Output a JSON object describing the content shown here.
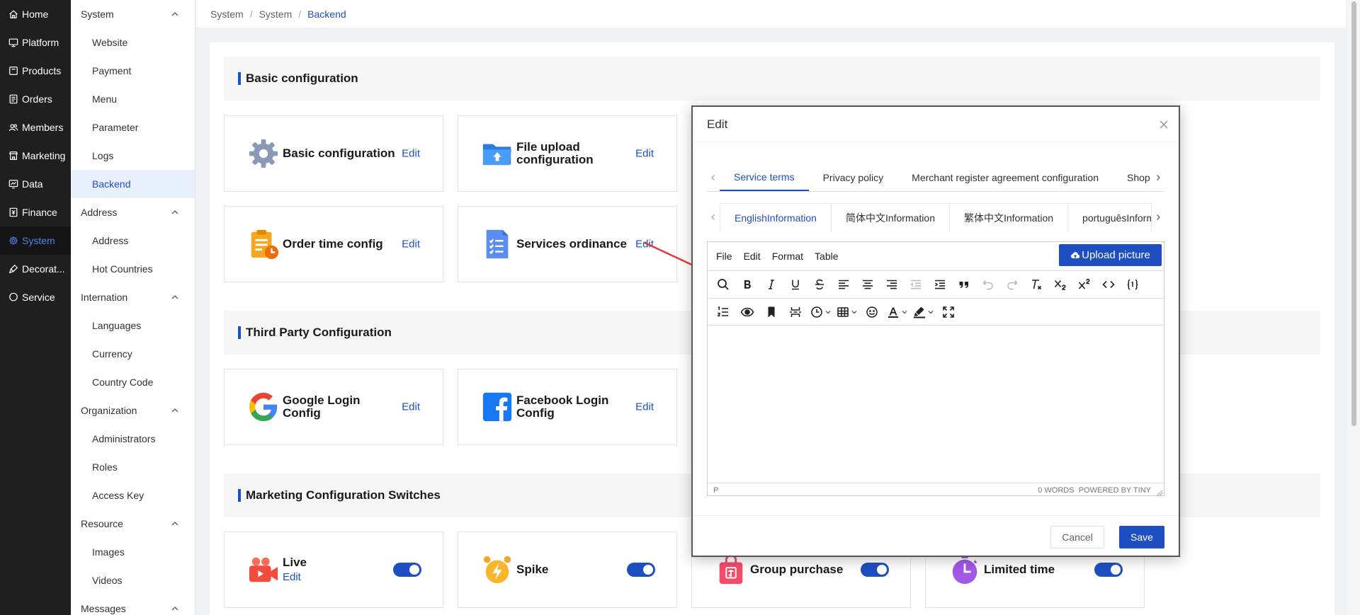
{
  "rail": [
    {
      "label": "Home",
      "icon": "home-icon"
    },
    {
      "label": "Platform",
      "icon": "monitor-icon"
    },
    {
      "label": "Products",
      "icon": "box-icon"
    },
    {
      "label": "Orders",
      "icon": "receipt-icon"
    },
    {
      "label": "Members",
      "icon": "users-icon"
    },
    {
      "label": "Marketing",
      "icon": "store-icon"
    },
    {
      "label": "Data",
      "icon": "chart-icon"
    },
    {
      "label": "Finance",
      "icon": "finance-icon"
    },
    {
      "label": "System",
      "icon": "gear-icon",
      "active": true
    },
    {
      "label": "Decorat...",
      "icon": "brush-icon"
    },
    {
      "label": "Service",
      "icon": "chat-icon"
    }
  ],
  "submenu": {
    "groups": [
      {
        "label": "System",
        "items": [
          "Website",
          "Payment",
          "Menu",
          "Parameter",
          "Logs",
          "Backend"
        ]
      },
      {
        "label": "Address",
        "items": [
          "Address",
          "Hot Countries"
        ]
      },
      {
        "label": "Internation",
        "items": [
          "Languages",
          "Currency",
          "Country Code"
        ]
      },
      {
        "label": "Organization",
        "items": [
          "Administrators",
          "Roles",
          "Access Key"
        ]
      },
      {
        "label": "Resource",
        "items": [
          "Images",
          "Videos"
        ]
      },
      {
        "label": "Messages",
        "items": []
      }
    ],
    "active_item": "Backend"
  },
  "breadcrumb": {
    "first": "System",
    "second": "System",
    "current": "Backend",
    "separator": "/"
  },
  "sections": {
    "basic": "Basic configuration",
    "third_party": "Third Party Configuration",
    "marketing": "Marketing Configuration Switches"
  },
  "cards": {
    "basic_config": {
      "title": "Basic configuration",
      "action": "Edit"
    },
    "file_upload": {
      "title": "File upload configuration",
      "action": "Edit"
    },
    "order_time": {
      "title": "Order time config",
      "action": "Edit"
    },
    "services_ordinance": {
      "title": "Services ordinance",
      "action": "Edit"
    },
    "google_login": {
      "title": "Google Login Config",
      "action": "Edit"
    },
    "facebook_login": {
      "title": "Facebook Login Config",
      "action": "Edit"
    },
    "live": {
      "title": "Live",
      "action": "Edit",
      "enabled": true
    },
    "spike": {
      "title": "Spike",
      "enabled": true
    },
    "group_purchase": {
      "title": "Group purchase",
      "enabled": true
    },
    "limited_time": {
      "title": "Limited time",
      "enabled": true
    }
  },
  "modal": {
    "title": "Edit",
    "tabs": [
      "Service terms",
      "Privacy policy",
      "Merchant register agreement configuration",
      "Shop"
    ],
    "active_tab": 0,
    "lang_tabs": [
      "EnglishInformation",
      "简体中文Information",
      "繁体中文Information",
      "portuguêsInform"
    ],
    "active_lang_tab": 0,
    "editor": {
      "menus": [
        "File",
        "Edit",
        "Format",
        "Table"
      ],
      "upload_label": "Upload picture",
      "status_path": "P",
      "status_words": "0 WORDS",
      "status_powered": "POWERED BY TINY"
    },
    "cancel_label": "Cancel",
    "save_label": "Save"
  },
  "colors": {
    "accent": "#1e4fc2",
    "rail_bg": "#1f1f1f",
    "arrow": "#e53935"
  }
}
